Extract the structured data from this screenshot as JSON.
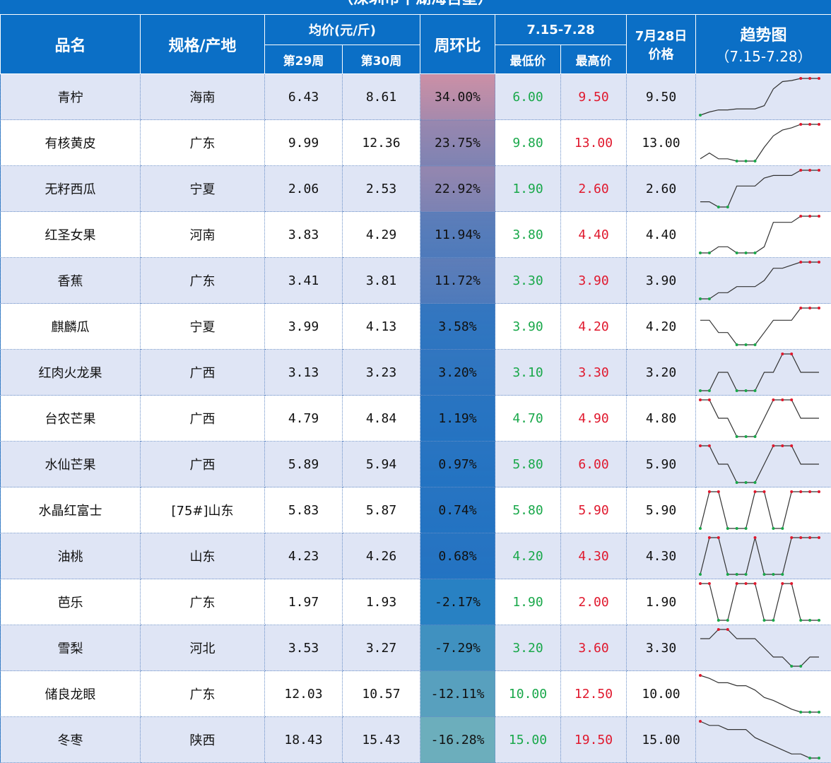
{
  "subtitle": "（深圳市平湖海吉星）",
  "headers": {
    "name": "品名",
    "spec": "规格/产地",
    "avg": "均价(元/斤)",
    "week29": "第29周",
    "week30": "第30周",
    "wow": "周环比",
    "range": "7.15-7.28",
    "low": "最低价",
    "high": "最高价",
    "price_date": "7月28日",
    "price_label": "价格",
    "trend": "趋势图",
    "trend_range": "（7.15-7.28）"
  },
  "colors": {
    "header_bg": "#0b6fc6",
    "low_text": "#19a84a",
    "high_text": "#e0182d",
    "row_odd": "#dfe5f5",
    "row_even": "#ffffff"
  },
  "rows": [
    {
      "name": "青柠",
      "spec": "海南",
      "w29": "6.43",
      "w30": "8.61",
      "wow": "34.00%",
      "wow_value": 34.0,
      "low": "6.00",
      "high": "9.50",
      "price": "9.50",
      "trend": [
        6.0,
        6.3,
        6.5,
        6.5,
        6.6,
        6.6,
        6.6,
        6.9,
        8.5,
        9.2,
        9.3,
        9.5,
        9.5,
        9.5
      ]
    },
    {
      "name": "有核黄皮",
      "spec": "广东",
      "w29": "9.99",
      "w30": "12.36",
      "wow": "23.75%",
      "wow_value": 23.75,
      "low": "9.80",
      "high": "13.00",
      "price": "13.00",
      "trend": [
        10.0,
        10.5,
        10.0,
        10.0,
        9.8,
        9.8,
        9.8,
        11.0,
        12.0,
        12.5,
        12.7,
        13.0,
        13.0,
        13.0
      ]
    },
    {
      "name": "无籽西瓜",
      "spec": "宁夏",
      "w29": "2.06",
      "w30": "2.53",
      "wow": "22.92%",
      "wow_value": 22.92,
      "low": "1.90",
      "high": "2.60",
      "price": "2.60",
      "trend": [
        2.0,
        2.0,
        1.9,
        1.9,
        2.3,
        2.3,
        2.3,
        2.45,
        2.5,
        2.5,
        2.5,
        2.6,
        2.6,
        2.6
      ]
    },
    {
      "name": "红圣女果",
      "spec": "河南",
      "w29": "3.83",
      "w30": "4.29",
      "wow": "11.94%",
      "wow_value": 11.94,
      "low": "3.80",
      "high": "4.40",
      "price": "4.40",
      "trend": [
        3.8,
        3.8,
        3.9,
        3.9,
        3.8,
        3.8,
        3.8,
        3.9,
        4.3,
        4.3,
        4.3,
        4.4,
        4.4,
        4.4
      ]
    },
    {
      "name": "香蕉",
      "spec": "广东",
      "w29": "3.41",
      "w30": "3.81",
      "wow": "11.72%",
      "wow_value": 11.72,
      "low": "3.30",
      "high": "3.90",
      "price": "3.90",
      "trend": [
        3.3,
        3.3,
        3.4,
        3.4,
        3.5,
        3.5,
        3.5,
        3.6,
        3.8,
        3.8,
        3.85,
        3.9,
        3.9,
        3.9
      ]
    },
    {
      "name": "麒麟瓜",
      "spec": "宁夏",
      "w29": "3.99",
      "w30": "4.13",
      "wow": "3.58%",
      "wow_value": 3.58,
      "low": "3.90",
      "high": "4.20",
      "price": "4.20",
      "trend": [
        4.1,
        4.1,
        4.0,
        4.0,
        3.9,
        3.9,
        3.9,
        4.0,
        4.1,
        4.1,
        4.1,
        4.2,
        4.2,
        4.2
      ]
    },
    {
      "name": "红肉火龙果",
      "spec": "广西",
      "w29": "3.13",
      "w30": "3.23",
      "wow": "3.20%",
      "wow_value": 3.2,
      "low": "3.10",
      "high": "3.30",
      "price": "3.20",
      "trend": [
        3.1,
        3.1,
        3.2,
        3.2,
        3.1,
        3.1,
        3.1,
        3.2,
        3.2,
        3.3,
        3.3,
        3.2,
        3.2,
        3.2
      ]
    },
    {
      "name": "台农芒果",
      "spec": "广西",
      "w29": "4.79",
      "w30": "4.84",
      "wow": "1.19%",
      "wow_value": 1.19,
      "low": "4.70",
      "high": "4.90",
      "price": "4.80",
      "trend": [
        4.9,
        4.9,
        4.8,
        4.8,
        4.7,
        4.7,
        4.7,
        4.8,
        4.9,
        4.9,
        4.9,
        4.8,
        4.8,
        4.8
      ]
    },
    {
      "name": "水仙芒果",
      "spec": "广西",
      "w29": "5.89",
      "w30": "5.94",
      "wow": "0.97%",
      "wow_value": 0.97,
      "low": "5.80",
      "high": "6.00",
      "price": "5.90",
      "trend": [
        6.0,
        6.0,
        5.9,
        5.9,
        5.8,
        5.8,
        5.8,
        5.9,
        6.0,
        6.0,
        6.0,
        5.9,
        5.9,
        5.9
      ]
    },
    {
      "name": "水晶红富士",
      "spec": "[75#]山东",
      "w29": "5.83",
      "w30": "5.87",
      "wow": "0.74%",
      "wow_value": 0.74,
      "low": "5.80",
      "high": "5.90",
      "price": "5.90",
      "trend": [
        5.8,
        5.9,
        5.9,
        5.8,
        5.8,
        5.8,
        5.9,
        5.9,
        5.8,
        5.8,
        5.9,
        5.9,
        5.9,
        5.9
      ]
    },
    {
      "name": "油桃",
      "spec": "山东",
      "w29": "4.23",
      "w30": "4.26",
      "wow": "0.68%",
      "wow_value": 0.68,
      "low": "4.20",
      "high": "4.30",
      "price": "4.30",
      "trend": [
        4.2,
        4.3,
        4.3,
        4.2,
        4.2,
        4.2,
        4.3,
        4.2,
        4.2,
        4.2,
        4.3,
        4.3,
        4.3,
        4.3
      ]
    },
    {
      "name": "芭乐",
      "spec": "广东",
      "w29": "1.97",
      "w30": "1.93",
      "wow": "-2.17%",
      "wow_value": -2.17,
      "low": "1.90",
      "high": "2.00",
      "price": "1.90",
      "trend": [
        2.0,
        2.0,
        1.9,
        1.9,
        2.0,
        2.0,
        2.0,
        1.9,
        1.9,
        2.0,
        2.0,
        1.9,
        1.9,
        1.9
      ]
    },
    {
      "name": "雪梨",
      "spec": "河北",
      "w29": "3.53",
      "w30": "3.27",
      "wow": "-7.29%",
      "wow_value": -7.29,
      "low": "3.20",
      "high": "3.60",
      "price": "3.30",
      "trend": [
        3.5,
        3.5,
        3.6,
        3.6,
        3.5,
        3.5,
        3.5,
        3.4,
        3.3,
        3.3,
        3.2,
        3.2,
        3.3,
        3.3
      ]
    },
    {
      "name": "储良龙眼",
      "spec": "广东",
      "w29": "12.03",
      "w30": "10.57",
      "wow": "-12.11%",
      "wow_value": -12.11,
      "low": "10.00",
      "high": "12.50",
      "price": "10.00",
      "trend": [
        12.5,
        12.3,
        12.0,
        12.0,
        11.8,
        11.8,
        11.5,
        11.0,
        10.8,
        10.5,
        10.2,
        10.0,
        10.0,
        10.0
      ]
    },
    {
      "name": "冬枣",
      "spec": "陕西",
      "w29": "18.43",
      "w30": "15.43",
      "wow": "-16.28%",
      "wow_value": -16.28,
      "low": "15.00",
      "high": "19.50",
      "price": "15.00",
      "trend": [
        19.5,
        19.0,
        19.0,
        18.5,
        18.5,
        18.5,
        17.5,
        17.0,
        16.5,
        16.0,
        15.5,
        15.5,
        15.0,
        15.0
      ]
    }
  ]
}
